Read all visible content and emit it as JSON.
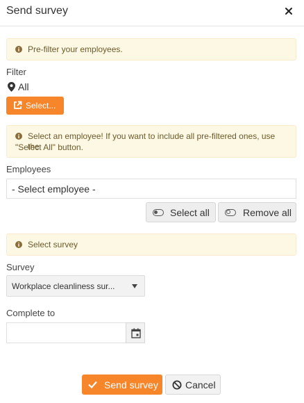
{
  "dialog": {
    "title": "Send survey",
    "close_icon": "close-icon"
  },
  "alerts": {
    "prefilter": "Pre-filter your employees.",
    "select_employee_line1": "Select an employee! If you want to include all pre-filtered ones, use the",
    "select_employee_line2": "\"Select All\" button.",
    "select_survey": "Select survey",
    "icon": "info-icon"
  },
  "filter": {
    "label": "Filter",
    "value": "All",
    "value_icon": "map-marker-icon",
    "select_button": "Select...",
    "select_button_icon": "external-link-icon"
  },
  "employees": {
    "label": "Employees",
    "placeholder": "- Select employee -",
    "select_all_button": "Select all",
    "remove_all_button": "Remove all",
    "toggle_icon": "toggle-icon"
  },
  "survey": {
    "label": "Survey",
    "selected_value": "Workplace cleanliness sur...",
    "caret_icon": "caret-down-icon"
  },
  "complete_to": {
    "label": "Complete to",
    "value": "",
    "calendar_icon": "calendar-icon"
  },
  "footer": {
    "send_button": "Send survey",
    "send_icon": "check-icon",
    "cancel_button": "Cancel",
    "cancel_icon": "ban-icon"
  },
  "colors": {
    "accent": "#f7852a",
    "alert_bg": "#fcf8e3",
    "alert_border": "#faebcc",
    "alert_icon": "#8a6d3b"
  }
}
